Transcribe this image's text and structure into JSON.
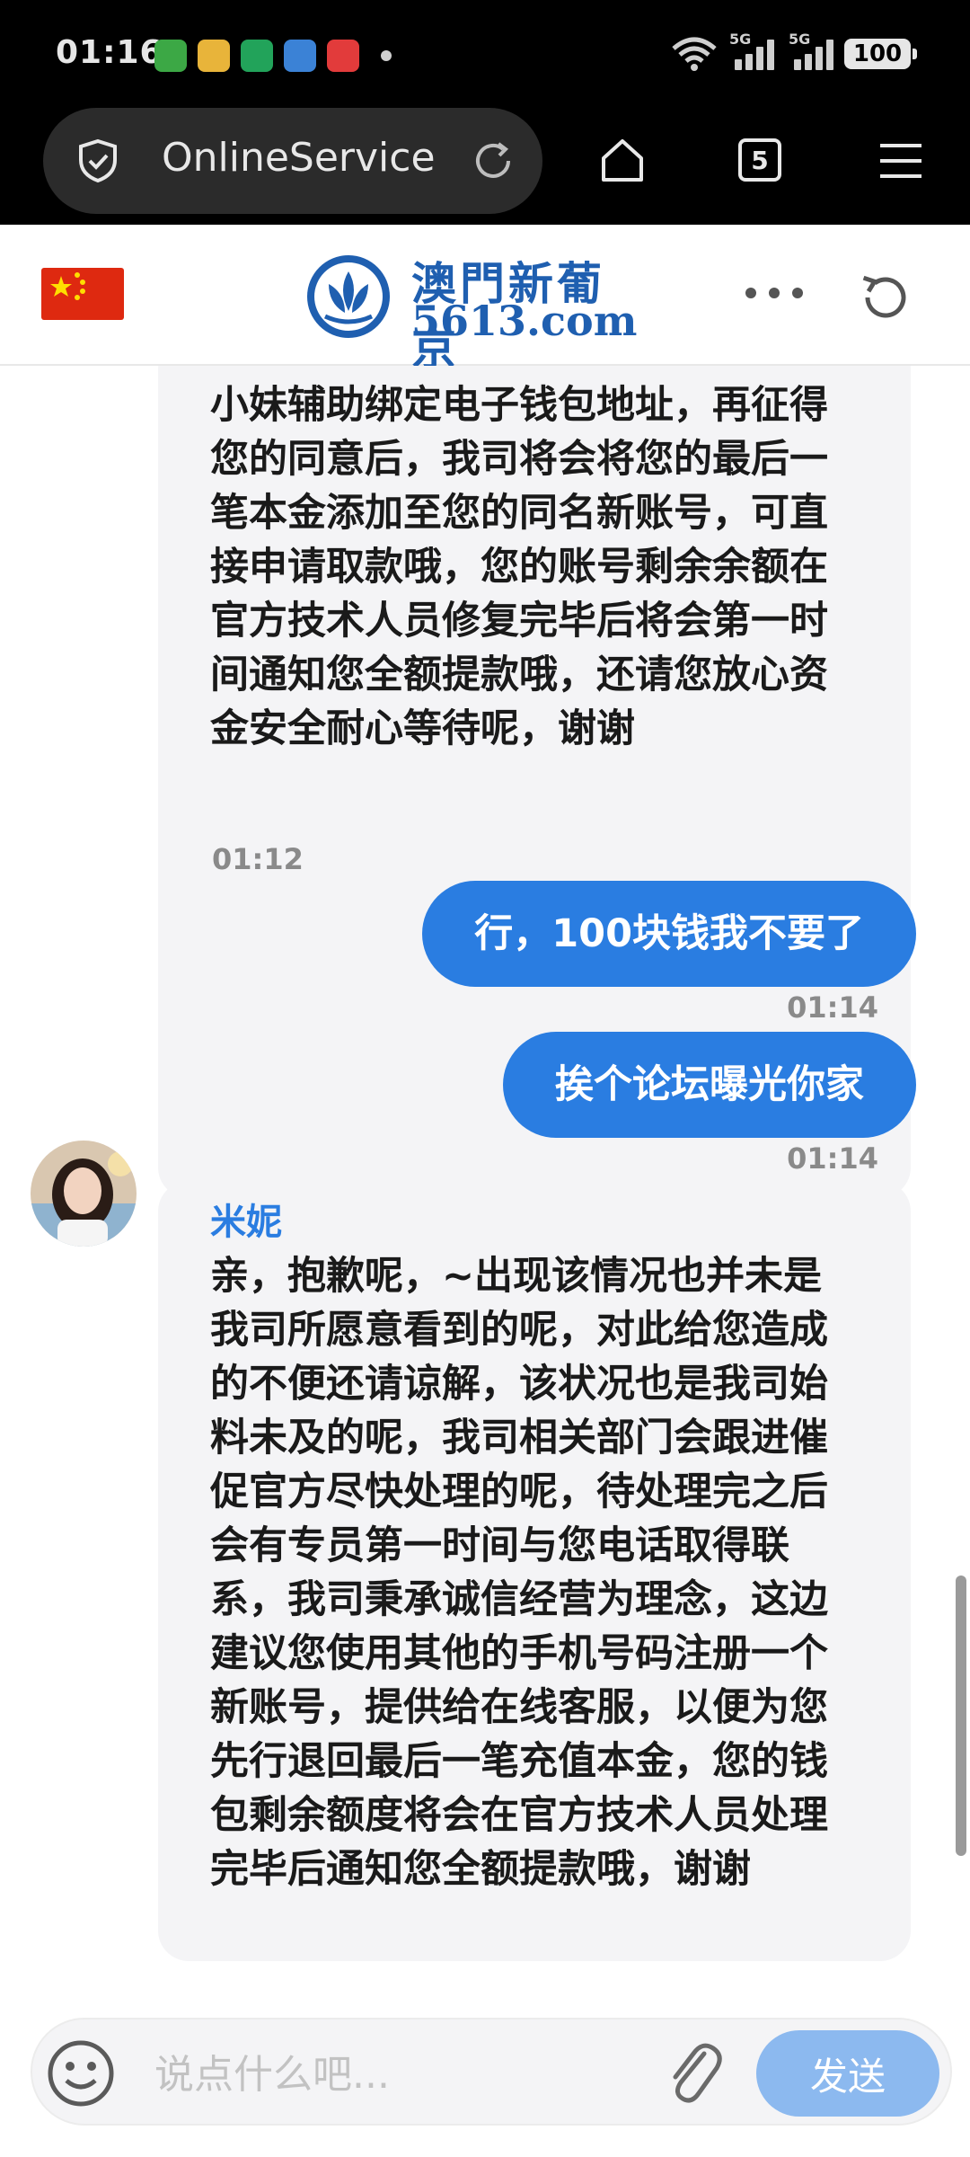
{
  "status_bar": {
    "time": "01:16",
    "network_1": "5G",
    "network_2": "5G",
    "battery": "100"
  },
  "browser": {
    "url": "OnlineService",
    "tab_count": "5"
  },
  "header": {
    "logo_cn": "澳門新葡京",
    "logo_en": "5613.com"
  },
  "messages": [
    {
      "direction": "incoming",
      "text": "小妹辅助绑定电子钱包地址，再征得您的同意后，我司将会将您的最后一笔本金添加至您的同名新账号，可直接申请取款哦，您的账号剩余余额在官方技术人员修复完毕后将会第一时间通知您全额提款哦，还请您放心资金安全耐心等待呢，谢谢",
      "time": "01:12"
    },
    {
      "direction": "outgoing",
      "text": "行，100块钱我不要了",
      "time": "01:14"
    },
    {
      "direction": "outgoing",
      "text": "挨个论坛曝光你家",
      "time": "01:14"
    },
    {
      "direction": "incoming",
      "sender": "米妮",
      "text": "亲，抱歉呢，~出现该情况也并未是我司所愿意看到的呢，对此给您造成的不便还请谅解，该状况也是我司始料未及的呢，我司相关部门会跟进催促官方尽快处理的呢，待处理完之后会有专员第一时间与您电话取得联系，我司秉承诚信经营为理念，这边建议您使用其他的手机号码注册一个新账号，提供给在线客服，以便为您先行退回最后一笔充值本金，您的钱包剩余额度将会在官方技术人员处理完毕后通知您全额提款哦，谢谢"
    }
  ],
  "composer": {
    "placeholder": "说点什么吧...",
    "send_label": "发送"
  },
  "colors": {
    "accent": "#2a7de1",
    "send_disabled": "#8cb9ef",
    "incoming_bubble": "#f4f4f6"
  }
}
